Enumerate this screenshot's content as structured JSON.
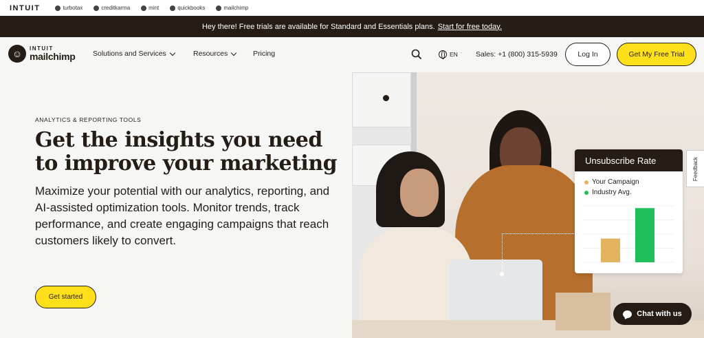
{
  "intuit_bar": {
    "logo": "INTUIT",
    "brands": [
      {
        "label": "turbotax",
        "icon": "turbotax-icon"
      },
      {
        "label": "creditkarma",
        "icon": "creditkarma-icon"
      },
      {
        "label": "mint",
        "icon": "mint-icon"
      },
      {
        "label": "quickbooks",
        "icon": "quickbooks-icon"
      },
      {
        "label": "mailchimp",
        "icon": "mailchimp-icon"
      }
    ]
  },
  "announcement": {
    "text": "Hey there! Free trials are available for Standard and Essentials plans.",
    "link": "Start for free today."
  },
  "nav": {
    "logo_top": "INTUIT",
    "logo_bottom": "mailchimp",
    "items": [
      "Solutions and Services",
      "Resources",
      "Pricing"
    ],
    "language": "EN",
    "sales": "Sales: +1 (800) 315-5939",
    "login": "Log In",
    "trial": "Get My Free Trial"
  },
  "hero": {
    "eyebrow": "ANALYTICS & REPORTING TOOLS",
    "headline": "Get the insights you need to improve your marketing",
    "lead": "Maximize your potential with our analytics, reporting, and AI-assisted optimization tools. Monitor trends, track performance, and create engaging campaigns that reach customers likely to convert.",
    "cta": "Get started"
  },
  "card": {
    "title": "Unsubscribe Rate",
    "legend": [
      {
        "label": "Your Campaign",
        "color": "#e3b35f"
      },
      {
        "label": "Industry Avg.",
        "color": "#1fbf5a"
      }
    ]
  },
  "chart_data": {
    "type": "bar",
    "title": "Unsubscribe Rate",
    "categories": [
      "Your Campaign",
      "Industry Avg."
    ],
    "values": [
      0.42,
      0.96
    ],
    "colors": [
      "#e3b35f",
      "#1fbf5a"
    ],
    "ylim": [
      0,
      1
    ],
    "grid": "horizontal"
  },
  "feedback": "Feedback",
  "chat": "Chat with us"
}
